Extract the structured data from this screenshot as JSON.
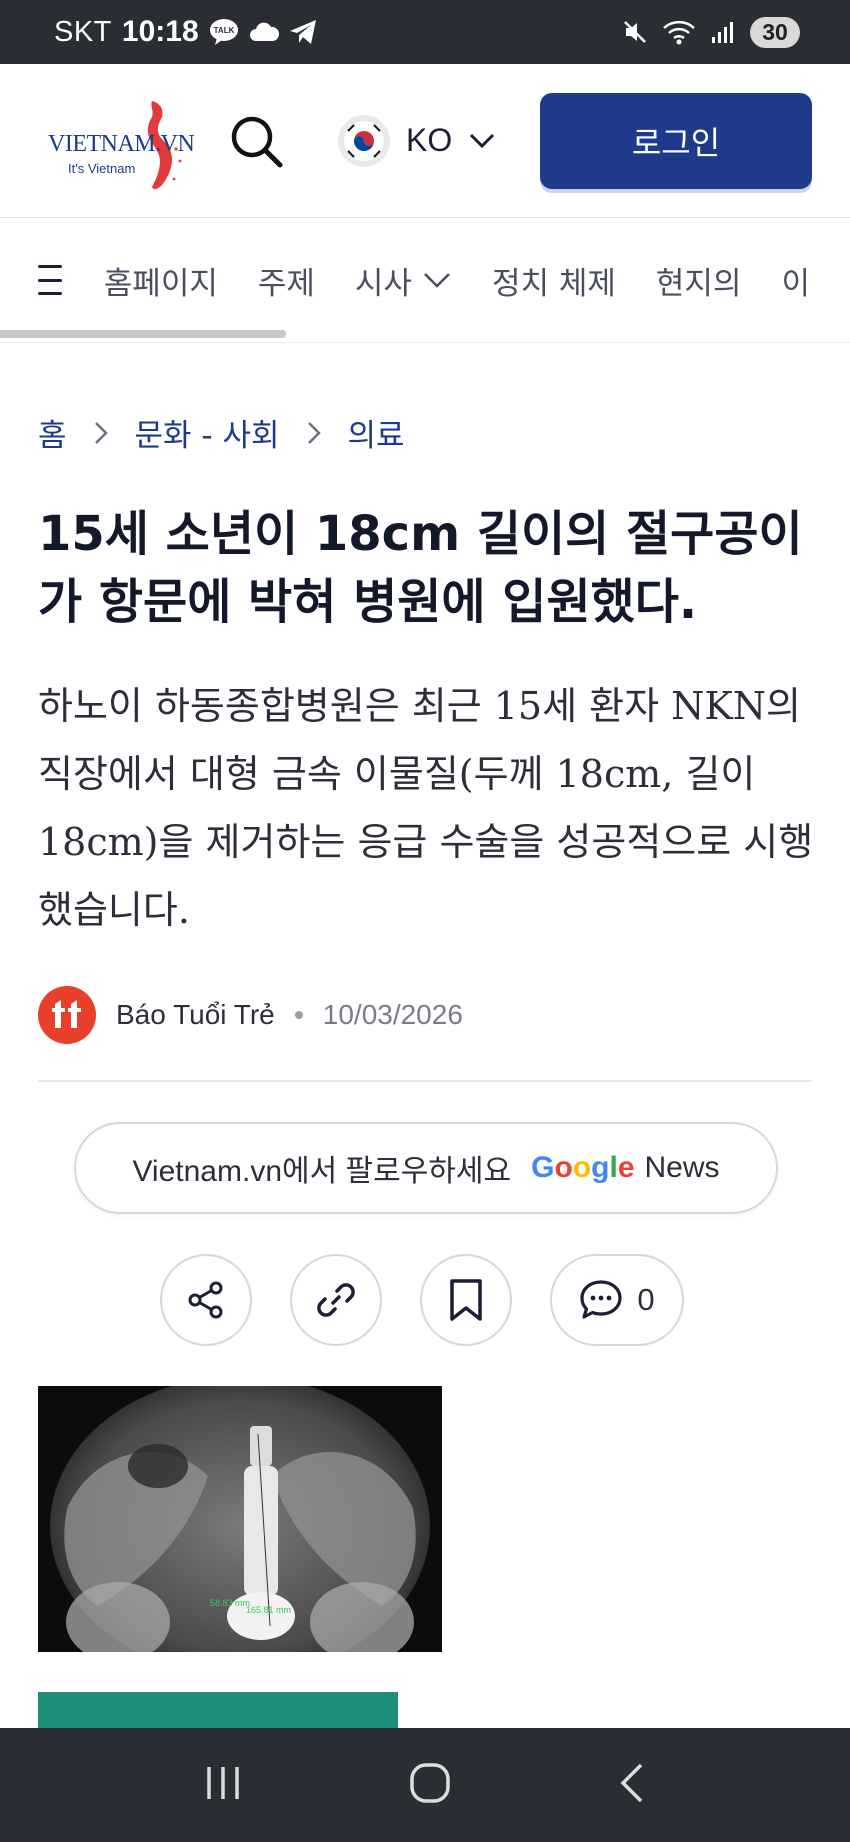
{
  "status_bar": {
    "carrier": "SKT",
    "time": "10:18",
    "battery": "30",
    "icons": [
      "talk-icon",
      "cloud-icon",
      "telegram-icon",
      "mute-icon",
      "wifi-icon",
      "signal-icon"
    ]
  },
  "header": {
    "logo_text": "VIETNAM.VN",
    "logo_sub": "It's Vietnam",
    "language": "KO",
    "login_label": "로그인",
    "accent_color": "#1e3a8a"
  },
  "nav": {
    "items": [
      "홈페이지",
      "주제",
      "시사",
      "정치 체제",
      "현지의",
      "이"
    ]
  },
  "breadcrumb": [
    "홈",
    "문화 - 사회",
    "의료"
  ],
  "article": {
    "title": "15세 소년이 18cm 길이의 절구공이가 항문에 박혀 병원에 입원했다.",
    "summary": "하노이 하동종합병원은 최근 15세 환자 NKN의 직장에서 대형 금속 이물질(두께 18cm, 길이 18cm)을 제거하는 응급 수술을 성공적으로 시행했습니다.",
    "source": "Báo Tuổi Trẻ",
    "date": "10/03/2026"
  },
  "follow": {
    "text": "Vietnam.vn에서 팔로우하세요",
    "google_letters": [
      "G",
      "o",
      "o",
      "g",
      "l",
      "e"
    ],
    "news": "News"
  },
  "actions": {
    "comment_count": "0"
  },
  "xray_labels": {
    "width_label": "58.83 mm",
    "length_label": "165.81 mm"
  }
}
